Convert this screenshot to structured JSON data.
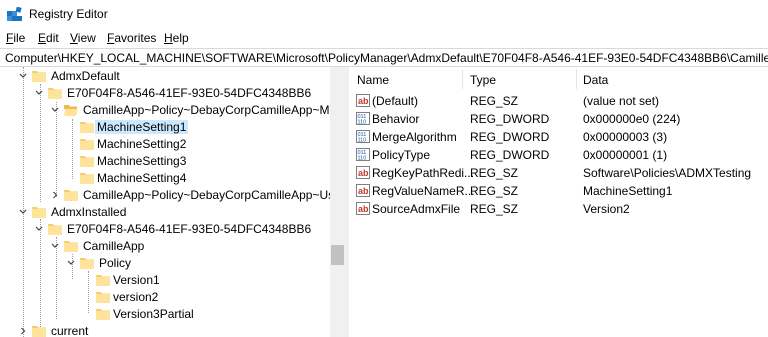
{
  "window": {
    "title": "Registry Editor"
  },
  "menu": [
    {
      "label": "File",
      "key": "F",
      "rest": "ile"
    },
    {
      "label": "Edit",
      "key": "E",
      "rest": "dit"
    },
    {
      "label": "View",
      "key": "V",
      "rest": "iew"
    },
    {
      "label": "Favorites",
      "key": "F",
      "rest": "avorites",
      "prefix": "Fa"
    },
    {
      "label": "Help",
      "key": "H",
      "rest": "elp"
    }
  ],
  "address": "Computer\\HKEY_LOCAL_MACHINE\\SOFTWARE\\Microsoft\\PolicyManager\\AdmxDefault\\E70F04F8-A546-41EF-93E0-54DFC4348BB6\\CamilleApp~Policy~",
  "tree": [
    {
      "label": "AdmxDefault"
    },
    {
      "label": "E70F04F8-A546-41EF-93E0-54DFC4348BB6"
    },
    {
      "label": "CamilleApp~Policy~DebayCorpCamilleApp~Mac"
    },
    {
      "label": "MachineSetting1"
    },
    {
      "label": "MachineSetting2"
    },
    {
      "label": "MachineSetting3"
    },
    {
      "label": "MachineSetting4"
    },
    {
      "label": "CamilleApp~Policy~DebayCorpCamilleApp~User"
    },
    {
      "label": "AdmxInstalled"
    },
    {
      "label": "E70F04F8-A546-41EF-93E0-54DFC4348BB6"
    },
    {
      "label": "CamilleApp"
    },
    {
      "label": "Policy"
    },
    {
      "label": "Version1"
    },
    {
      "label": "version2"
    },
    {
      "label": "Version3Partial"
    },
    {
      "label": "current"
    }
  ],
  "columns": {
    "name": "Name",
    "type": "Type",
    "data": "Data"
  },
  "values": [
    {
      "icon": "string-value-icon",
      "name": "(Default)",
      "type": "REG_SZ",
      "data": "(value not set)"
    },
    {
      "icon": "binary-value-icon",
      "name": "Behavior",
      "type": "REG_DWORD",
      "data": "0x000000e0 (224)"
    },
    {
      "icon": "binary-value-icon",
      "name": "MergeAlgorithm",
      "type": "REG_DWORD",
      "data": "0x00000003 (3)"
    },
    {
      "icon": "binary-value-icon",
      "name": "PolicyType",
      "type": "REG_DWORD",
      "data": "0x00000001 (1)"
    },
    {
      "icon": "string-value-icon",
      "name": "RegKeyPathRedi...",
      "type": "REG_SZ",
      "data": "Software\\Policies\\ADMXTesting"
    },
    {
      "icon": "string-value-icon",
      "name": "RegValueNameR...",
      "type": "REG_SZ",
      "data": "MachineSetting1"
    },
    {
      "icon": "string-value-icon",
      "name": "SourceAdmxFile",
      "type": "REG_SZ",
      "data": "Version2"
    }
  ]
}
